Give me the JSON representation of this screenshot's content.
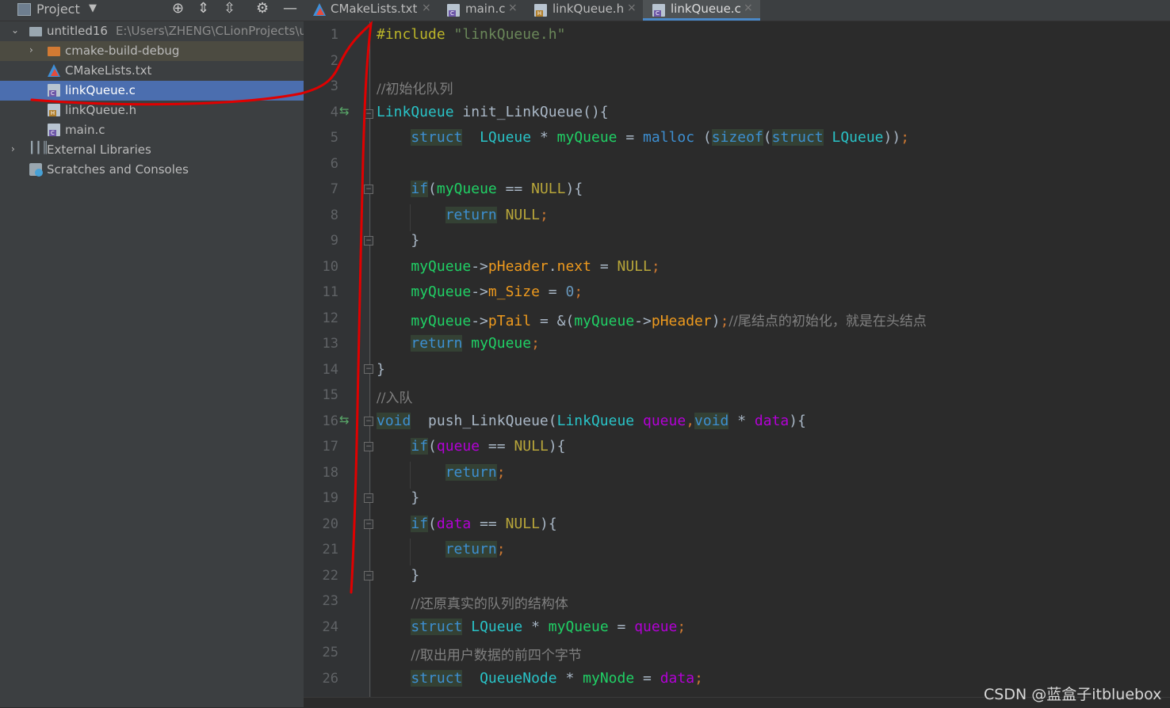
{
  "project_panel": {
    "title": "Project",
    "tools": [
      "crosshair-icon",
      "expand-icon",
      "collapse-icon",
      "gear-icon",
      "minimize-icon"
    ],
    "tree": [
      {
        "label": "untitled16",
        "path": "E:\\Users\\ZHENG\\CLionProjects\\u",
        "icon": "folder-icon"
      },
      {
        "label": "cmake-build-debug",
        "icon": "folder-icon"
      },
      {
        "label": "CMakeLists.txt",
        "icon": "cmake-icon"
      },
      {
        "label": "linkQueue.c",
        "icon": "c-file-icon",
        "selected": true
      },
      {
        "label": "linkQueue.h",
        "icon": "h-file-icon"
      },
      {
        "label": "main.c",
        "icon": "c-file-icon"
      },
      {
        "label": "External Libraries",
        "icon": "library-icon"
      },
      {
        "label": "Scratches and Consoles",
        "icon": "scratch-icon"
      }
    ]
  },
  "tabs": [
    {
      "label": "CMakeLists.txt",
      "icon": "cmake-icon"
    },
    {
      "label": "main.c",
      "icon": "c-file-icon"
    },
    {
      "label": "linkQueue.h",
      "icon": "h-file-icon"
    },
    {
      "label": "linkQueue.c",
      "icon": "c-file-icon",
      "active": true
    }
  ],
  "editor": {
    "line_numbers": [
      "1",
      "2",
      "3",
      "4",
      "5",
      "6",
      "7",
      "8",
      "9",
      "10",
      "11",
      "12",
      "13",
      "14",
      "15",
      "16",
      "17",
      "18",
      "19",
      "20",
      "21",
      "22",
      "23",
      "24",
      "25",
      "26"
    ],
    "tokens": {
      "l1_pp": "#include",
      "l1_str": "\"linkQueue.h\"",
      "l3_cm": "//初始化队列",
      "l4_ty": "LinkQueue",
      "l4_fn": "init_LinkQueue",
      "l4_rest": "(){",
      "struct": "struct",
      "lqueue": "LQueue",
      "star": "*",
      "myqueue": "myQueue",
      "eq": "=",
      "malloc": "malloc",
      "sizeof": "sizeof",
      "if": "if",
      "eqeq": "==",
      "null": "NULL",
      "return": "return",
      "arrow": "->",
      "pheader": "pHeader",
      "next": "next",
      "msize": "m_Size",
      "zero": "0",
      "ptail": "pTail",
      "amp": "&",
      "l12_cm": "//尾结点的初始化，就是在头结点",
      "l15_cm": "//入队",
      "void": "void",
      "push_fn": "push_LinkQueue",
      "linkqueue": "LinkQueue",
      "queue": "queue",
      "data": "data",
      "l23_cm": "//还原真实的队列的结构体",
      "l25_cm": "//取出用户数据的前四个字节",
      "queuenode": "QueueNode",
      "mynode": "myNode"
    }
  },
  "watermark": "CSDN @蓝盒子itbluebox",
  "colors": {
    "accent": "#4b6eaf",
    "annotation": "#e00000",
    "keyword": "#3d8fd1",
    "type": "#29c3c7",
    "function": "#20d065",
    "member": "#ee9a1e",
    "parameter": "#b300d6"
  }
}
